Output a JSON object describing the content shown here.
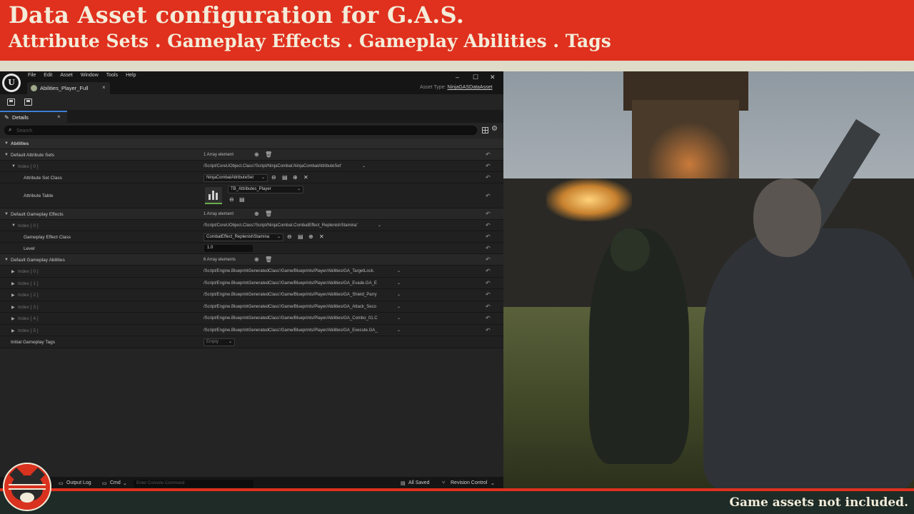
{
  "banner": {
    "title": "Data Asset configuration for G.A.S.",
    "subtitle": "Attribute Sets . Gameplay Effects . Gameplay Abilities . Tags"
  },
  "editor": {
    "menu": [
      "File",
      "Edit",
      "Asset",
      "Window",
      "Tools",
      "Help"
    ],
    "document_tab": "Abilities_Player_Full",
    "asset_type_label": "Asset Type:",
    "asset_type_value": "NinjaGASDataAsset",
    "panel_tab": "Details",
    "search_placeholder": "Search",
    "category": "Abilities",
    "attribute_sets": {
      "label": "Default Attribute Sets",
      "count": "1 Array element",
      "index_label": "Index [ 0 ]",
      "index_value": "/Script/CoreUObject.Class'/Script/NinjaCombat.NinjaCombatAttributeSet'",
      "class_label": "Attribute Set Class",
      "class_value": "NinjaCombatAttributeSet",
      "table_label": "Attribute Table",
      "table_value": "TB_Attributes_Player"
    },
    "gameplay_effects": {
      "label": "Default Gameplay Effects",
      "count": "1 Array element",
      "index_label": "Index [ 0 ]",
      "index_value": "/Script/CoreUObject.Class'/Script/NinjaCombat.CombatEffect_ReplenishStamina'",
      "class_label": "Gameplay Effect Class",
      "class_value": "CombatEffect_ReplenishStamina",
      "level_label": "Level",
      "level_value": "1.0"
    },
    "gameplay_abilities": {
      "label": "Default Gameplay Abilities",
      "count": "6 Array elements",
      "items": [
        {
          "index": "Index [ 0 ]",
          "value": "/Script/Engine.BlueprintGeneratedClass'/Game/Blueprints/Player/Abilities/GA_TargetLock."
        },
        {
          "index": "Index [ 1 ]",
          "value": "/Script/Engine.BlueprintGeneratedClass'/Game/Blueprints/Player/Abilities/GA_Evade.GA_E"
        },
        {
          "index": "Index [ 2 ]",
          "value": "/Script/Engine.BlueprintGeneratedClass'/Game/Blueprints/Player/Abilities/GA_Shield_Parry"
        },
        {
          "index": "Index [ 3 ]",
          "value": "/Script/Engine.BlueprintGeneratedClass'/Game/Blueprints/Player/Abilities/GA_Attack_Seco"
        },
        {
          "index": "Index [ 4 ]",
          "value": "/Script/Engine.BlueprintGeneratedClass'/Game/Blueprints/Player/Abilities/GA_Combo_01.C"
        },
        {
          "index": "Index [ 5 ]",
          "value": "/Script/Engine.BlueprintGeneratedClass'/Game/Blueprints/Player/Abilities/GA_Execute.GA_"
        }
      ]
    },
    "tags": {
      "label": "Initial Gameplay Tags",
      "value": "Empty"
    },
    "statusbar": {
      "output_log": "Output Log",
      "cmd": "Cmd",
      "console_placeholder": "Enter Console Command",
      "saved": "All Saved",
      "revision": "Revision Control"
    }
  },
  "footer": {
    "note": "Game assets not included."
  },
  "colors": {
    "accent_red": "#e0301e",
    "cream": "#f3ecd9",
    "editor_bg": "#242424",
    "footer_bg": "#1e2b27"
  }
}
